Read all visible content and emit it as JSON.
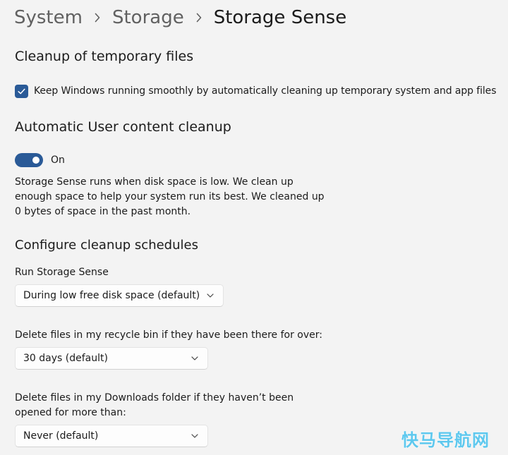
{
  "breadcrumb": {
    "items": [
      "System",
      "Storage",
      "Storage Sense"
    ]
  },
  "cleanup_temp": {
    "heading": "Cleanup of temporary files",
    "checkbox_label": "Keep Windows running smoothly by automatically cleaning up temporary system and app files",
    "checked": true
  },
  "auto_cleanup": {
    "heading": "Automatic User content cleanup",
    "toggle_state": "On",
    "description": "Storage Sense runs when disk space is low. We clean up enough space to help your system run its best. We cleaned up 0 bytes of space in the past month."
  },
  "schedules": {
    "heading": "Configure cleanup schedules",
    "run": {
      "label": "Run Storage Sense",
      "value": "During low free disk space (default)"
    },
    "recycle": {
      "label": "Delete files in my recycle bin if they have been there for over:",
      "value": "30 days (default)"
    },
    "downloads": {
      "label": "Delete files in my Downloads folder if they haven’t been opened for more than:",
      "value": "Never (default)"
    }
  },
  "watermark": "快马导航网",
  "colors": {
    "accent": "#2a5a97",
    "background": "#f3f3f3",
    "watermark": "#5ec8ee"
  },
  "icons": {
    "breadcrumb_separator": "chevron-right-icon",
    "checkbox": "checkmark-icon",
    "dropdown": "chevron-down-icon"
  }
}
